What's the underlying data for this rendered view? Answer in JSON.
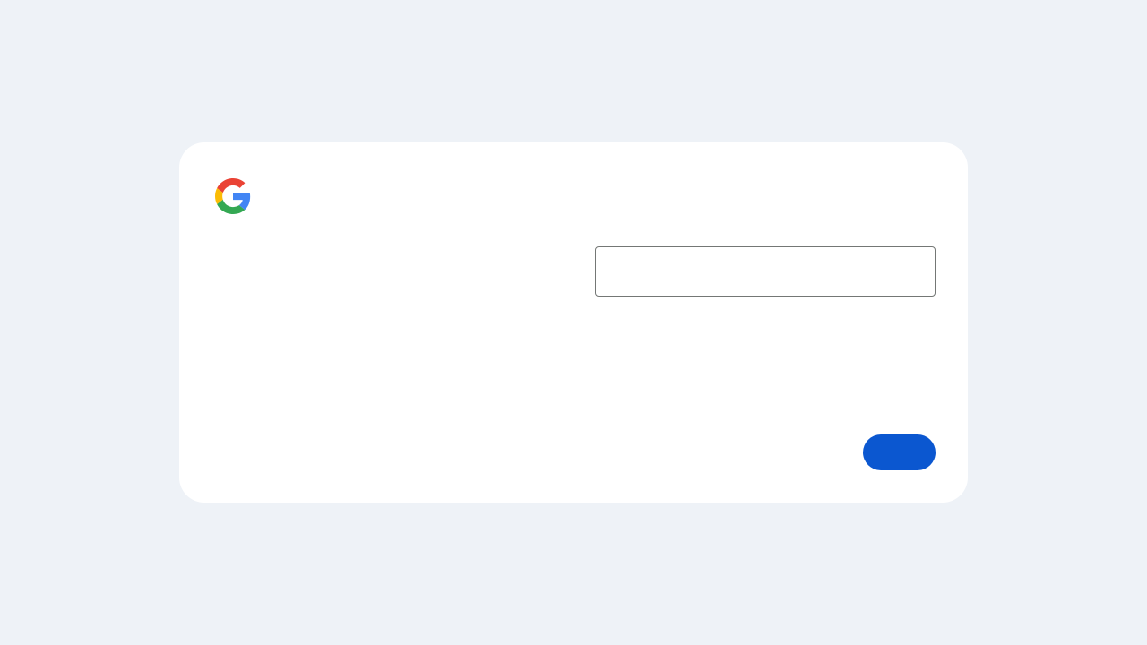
{
  "logo": {
    "icon": "google-g-logo",
    "colors": {
      "blue": "#4285F4",
      "red": "#EA4335",
      "yellow": "#FBBC05",
      "green": "#34A853"
    }
  },
  "form": {
    "input": {
      "value": "",
      "placeholder": ""
    },
    "primary_button": {
      "label": "",
      "color": "#0b57d0"
    }
  },
  "theme": {
    "background": "#eef2f7",
    "card": "#ffffff",
    "field_border": "#747775"
  }
}
